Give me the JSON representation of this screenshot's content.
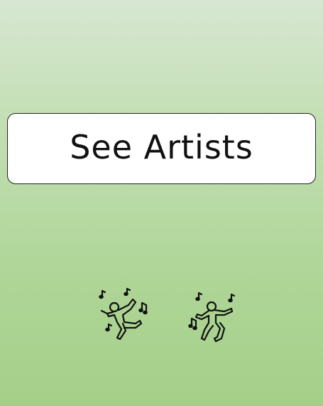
{
  "main": {
    "button_label": "See Artists"
  },
  "icons": {
    "left": "dancing-figure-icon",
    "right": "dancing-figure-icon"
  },
  "colors": {
    "background_top": "#d7e7d2",
    "background_bottom": "#a5cf89",
    "button_fill": "#ffffff",
    "button_border": "#222222",
    "text": "#111111"
  }
}
